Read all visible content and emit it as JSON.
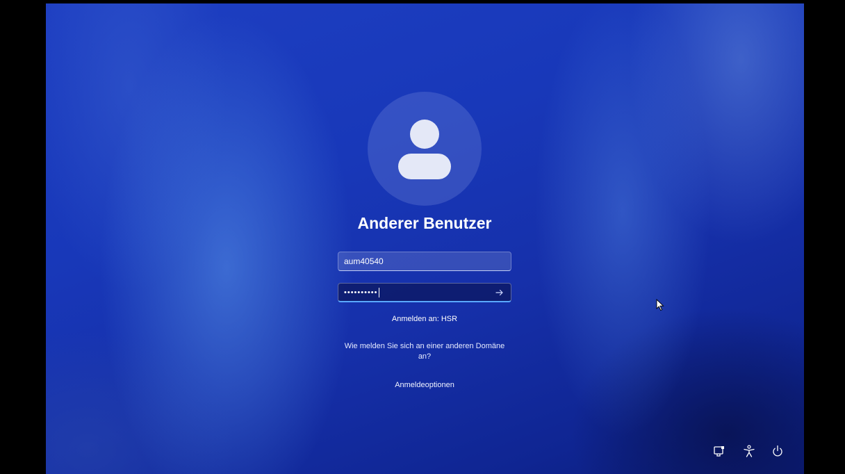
{
  "login": {
    "user_name": "Anderer Benutzer",
    "username_value": "aum40540",
    "password_masked": "••••••••••",
    "submit_icon": "arrow-right-icon",
    "sign_in_to": "Anmelden an: HSR",
    "other_domain_line1": "Wie melden Sie sich an einer anderen Domäne",
    "other_domain_line2": "an?",
    "sign_in_options": "Anmeldeoptionen"
  },
  "bottom_bar": {
    "icons": [
      "network-icon",
      "accessibility-icon",
      "power-icon"
    ]
  },
  "colors": {
    "background_primary": "#1838b9",
    "background_dark": "#0b1c78",
    "focus_accent": "#5aa9ff",
    "text": "#ffffff"
  }
}
